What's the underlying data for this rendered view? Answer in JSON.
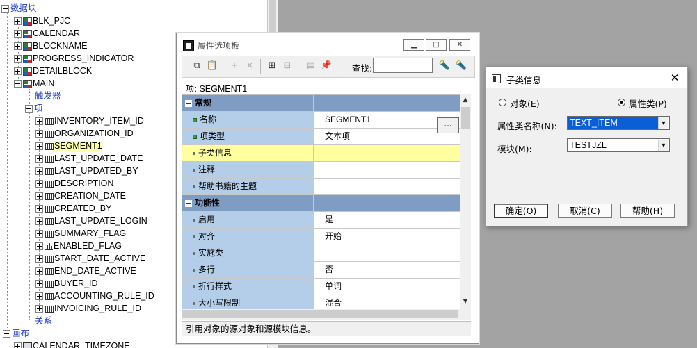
{
  "navigator": {
    "root_label": "数据块",
    "blocks": [
      "BLK_PJC",
      "CALENDAR",
      "BLOCKNAME",
      "PROGRESS_INDICATOR",
      "DETAILBLOCK",
      "MAIN"
    ],
    "triggers_label": "触发器",
    "items_label": "项",
    "items": [
      "INVENTORY_ITEM_ID",
      "ORGANIZATION_ID",
      "SEGMENT1",
      "LAST_UPDATE_DATE",
      "LAST_UPDATED_BY",
      "DESCRIPTION",
      "CREATION_DATE",
      "CREATED_BY",
      "LAST_UPDATE_LOGIN",
      "SUMMARY_FLAG",
      "ENABLED_FLAG",
      "START_DATE_ACTIVE",
      "END_DATE_ACTIVE",
      "BUYER_ID",
      "ACCOUNTING_RULE_ID",
      "INVOICING_RULE_ID"
    ],
    "selected_item": "SEGMENT1",
    "relations_label": "关系",
    "canvas_label": "画布",
    "canvas_items": [
      "CALENDAR_TIMEZONE"
    ]
  },
  "palette": {
    "title": "属性选项板",
    "find_label": "查找:",
    "find_value": "",
    "caption": "项: SEGMENT1",
    "categories": [
      {
        "name": "常规",
        "rows": [
          {
            "name": "名称",
            "value": "SEGMENT1",
            "marker": "green"
          },
          {
            "name": "项类型",
            "value": "文本项",
            "marker": "green"
          },
          {
            "name": "子类信息",
            "value": "",
            "marker": "dot",
            "highlight": true
          },
          {
            "name": "注释",
            "value": "",
            "marker": "dot"
          },
          {
            "name": "帮助书籍的主题",
            "value": "",
            "marker": "dot"
          }
        ]
      },
      {
        "name": "功能性",
        "rows": [
          {
            "name": "启用",
            "value": "是",
            "marker": "dot"
          },
          {
            "name": "对齐",
            "value": "开始",
            "marker": "dot"
          },
          {
            "name": "实施类",
            "value": "",
            "marker": "dot"
          },
          {
            "name": "多行",
            "value": "否",
            "marker": "dot"
          },
          {
            "name": "折行样式",
            "value": "单词",
            "marker": "dot"
          },
          {
            "name": "大小写限制",
            "value": "混合",
            "marker": "dot"
          }
        ]
      }
    ],
    "lov_button": "...",
    "status": "引用对象的源对象和源模块信息。"
  },
  "dialog": {
    "title": "子类信息",
    "radio_object": "对象(E)",
    "radio_property_class": "属性类(P)",
    "selected_radio": "property_class",
    "class_name_label": "属性类名称(N):",
    "class_name_value": "TEXT_ITEM",
    "module_label": "模块(M):",
    "module_value": "TESTJZL",
    "ok": "确定(O)",
    "cancel": "取消(C)",
    "help": "帮助(H)"
  }
}
